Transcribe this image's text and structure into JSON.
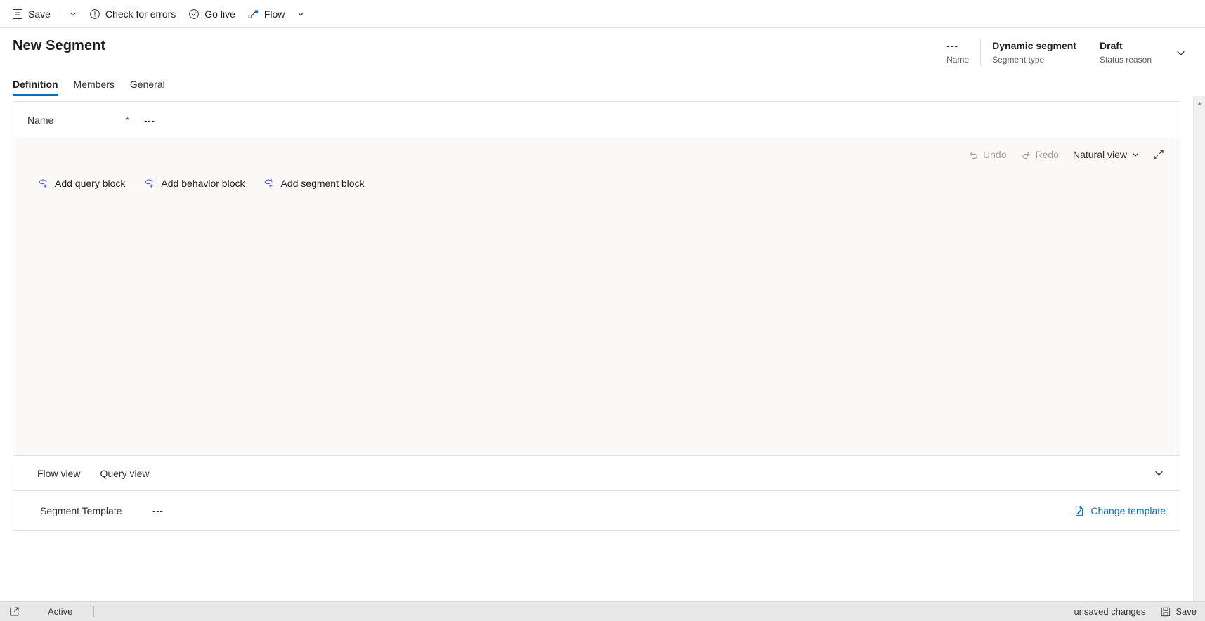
{
  "commandbar": {
    "save": {
      "label": "Save",
      "icon": "save-icon"
    },
    "save_caret": {
      "icon": "chevron-down-icon"
    },
    "check_errors": {
      "label": "Check for errors",
      "icon": "exclamation-circle-icon"
    },
    "go_live": {
      "label": "Go live",
      "icon": "check-circle-icon"
    },
    "flow": {
      "label": "Flow",
      "icon": "flow-icon"
    },
    "flow_caret": {
      "icon": "chevron-down-icon"
    }
  },
  "header": {
    "title": "New Segment",
    "fields": [
      {
        "value": "---",
        "label": "Name"
      },
      {
        "value": "Dynamic segment",
        "label": "Segment type"
      },
      {
        "value": "Draft",
        "label": "Status reason"
      }
    ],
    "collapse_icon": "chevron-down-icon"
  },
  "tabs": [
    {
      "label": "Definition",
      "active": true
    },
    {
      "label": "Members",
      "active": false
    },
    {
      "label": "General",
      "active": false
    }
  ],
  "form": {
    "name_field": {
      "label": "Name",
      "required_marker": "*",
      "value": "---"
    }
  },
  "canvas": {
    "toolbar": {
      "undo": {
        "label": "Undo",
        "icon": "undo-icon",
        "disabled": true
      },
      "redo": {
        "label": "Redo",
        "icon": "redo-icon",
        "disabled": true
      },
      "view_mode": {
        "label": "Natural view",
        "caret_icon": "chevron-down-icon"
      },
      "expand": {
        "icon": "expand-arrows-icon"
      }
    },
    "add_blocks": [
      {
        "label": "Add query block",
        "icon": "add-block-icon"
      },
      {
        "label": "Add behavior block",
        "icon": "add-block-icon"
      },
      {
        "label": "Add segment block",
        "icon": "add-block-icon"
      }
    ]
  },
  "view_section": {
    "tabs": [
      {
        "label": "Flow view"
      },
      {
        "label": "Query view"
      }
    ],
    "collapse_icon": "chevron-down-icon"
  },
  "template_section": {
    "label": "Segment Template",
    "value": "---",
    "change_button": {
      "label": "Change template",
      "icon": "edit-document-icon"
    }
  },
  "statusbar": {
    "expand_icon": "popout-icon",
    "state": "Active",
    "unsaved": "unsaved changes",
    "save": {
      "label": "Save",
      "icon": "save-icon"
    }
  },
  "colors": {
    "accent": "#0f6cbd",
    "required": "#a4262c",
    "link": "#0f6cbd",
    "canvas_bg": "#faf9f8",
    "border": "#e1dfdd",
    "statusbar_bg": "#e8e8e8"
  }
}
